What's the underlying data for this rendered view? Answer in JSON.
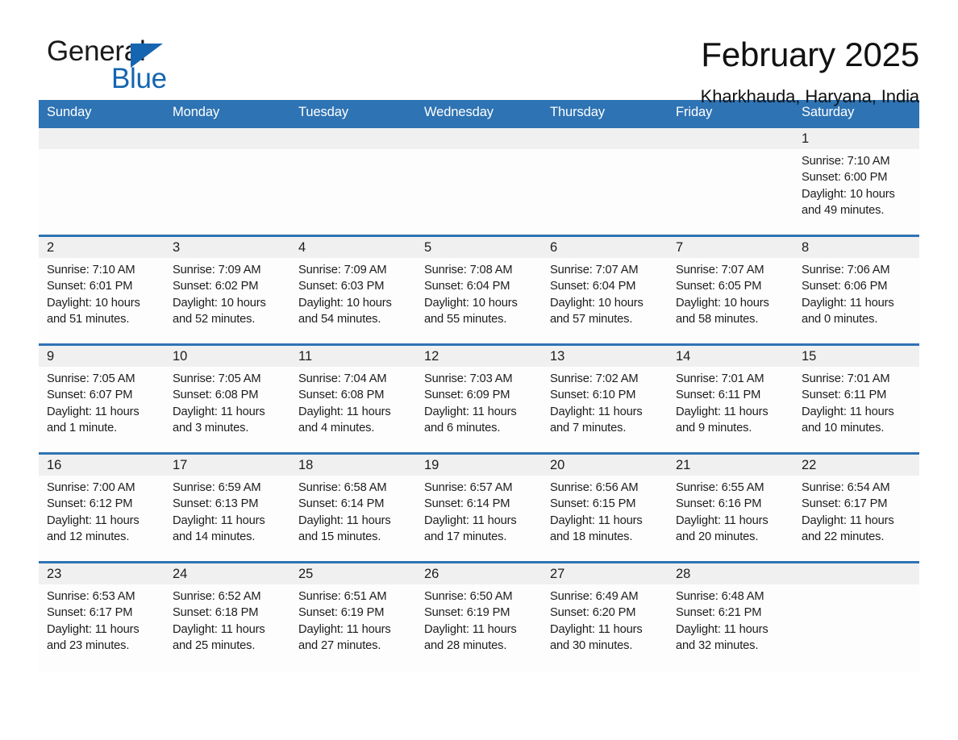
{
  "brand": {
    "name_part1": "General",
    "name_part2": "Blue"
  },
  "header": {
    "title": "February 2025",
    "subtitle": "Kharkhauda, Haryana, India"
  },
  "colors": {
    "accent_blue": "#2e73b3",
    "logo_blue": "#1565b0",
    "daynum_band": "#f0f0f0",
    "cell_bg": "#fdfdfd"
  },
  "weekday_headers": [
    "Sunday",
    "Monday",
    "Tuesday",
    "Wednesday",
    "Thursday",
    "Friday",
    "Saturday"
  ],
  "weeks": [
    [
      {
        "day": "",
        "sunrise": "",
        "sunset": "",
        "daylight": ""
      },
      {
        "day": "",
        "sunrise": "",
        "sunset": "",
        "daylight": ""
      },
      {
        "day": "",
        "sunrise": "",
        "sunset": "",
        "daylight": ""
      },
      {
        "day": "",
        "sunrise": "",
        "sunset": "",
        "daylight": ""
      },
      {
        "day": "",
        "sunrise": "",
        "sunset": "",
        "daylight": ""
      },
      {
        "day": "",
        "sunrise": "",
        "sunset": "",
        "daylight": ""
      },
      {
        "day": "1",
        "sunrise": "Sunrise: 7:10 AM",
        "sunset": "Sunset: 6:00 PM",
        "daylight": "Daylight: 10 hours and 49 minutes."
      }
    ],
    [
      {
        "day": "2",
        "sunrise": "Sunrise: 7:10 AM",
        "sunset": "Sunset: 6:01 PM",
        "daylight": "Daylight: 10 hours and 51 minutes."
      },
      {
        "day": "3",
        "sunrise": "Sunrise: 7:09 AM",
        "sunset": "Sunset: 6:02 PM",
        "daylight": "Daylight: 10 hours and 52 minutes."
      },
      {
        "day": "4",
        "sunrise": "Sunrise: 7:09 AM",
        "sunset": "Sunset: 6:03 PM",
        "daylight": "Daylight: 10 hours and 54 minutes."
      },
      {
        "day": "5",
        "sunrise": "Sunrise: 7:08 AM",
        "sunset": "Sunset: 6:04 PM",
        "daylight": "Daylight: 10 hours and 55 minutes."
      },
      {
        "day": "6",
        "sunrise": "Sunrise: 7:07 AM",
        "sunset": "Sunset: 6:04 PM",
        "daylight": "Daylight: 10 hours and 57 minutes."
      },
      {
        "day": "7",
        "sunrise": "Sunrise: 7:07 AM",
        "sunset": "Sunset: 6:05 PM",
        "daylight": "Daylight: 10 hours and 58 minutes."
      },
      {
        "day": "8",
        "sunrise": "Sunrise: 7:06 AM",
        "sunset": "Sunset: 6:06 PM",
        "daylight": "Daylight: 11 hours and 0 minutes."
      }
    ],
    [
      {
        "day": "9",
        "sunrise": "Sunrise: 7:05 AM",
        "sunset": "Sunset: 6:07 PM",
        "daylight": "Daylight: 11 hours and 1 minute."
      },
      {
        "day": "10",
        "sunrise": "Sunrise: 7:05 AM",
        "sunset": "Sunset: 6:08 PM",
        "daylight": "Daylight: 11 hours and 3 minutes."
      },
      {
        "day": "11",
        "sunrise": "Sunrise: 7:04 AM",
        "sunset": "Sunset: 6:08 PM",
        "daylight": "Daylight: 11 hours and 4 minutes."
      },
      {
        "day": "12",
        "sunrise": "Sunrise: 7:03 AM",
        "sunset": "Sunset: 6:09 PM",
        "daylight": "Daylight: 11 hours and 6 minutes."
      },
      {
        "day": "13",
        "sunrise": "Sunrise: 7:02 AM",
        "sunset": "Sunset: 6:10 PM",
        "daylight": "Daylight: 11 hours and 7 minutes."
      },
      {
        "day": "14",
        "sunrise": "Sunrise: 7:01 AM",
        "sunset": "Sunset: 6:11 PM",
        "daylight": "Daylight: 11 hours and 9 minutes."
      },
      {
        "day": "15",
        "sunrise": "Sunrise: 7:01 AM",
        "sunset": "Sunset: 6:11 PM",
        "daylight": "Daylight: 11 hours and 10 minutes."
      }
    ],
    [
      {
        "day": "16",
        "sunrise": "Sunrise: 7:00 AM",
        "sunset": "Sunset: 6:12 PM",
        "daylight": "Daylight: 11 hours and 12 minutes."
      },
      {
        "day": "17",
        "sunrise": "Sunrise: 6:59 AM",
        "sunset": "Sunset: 6:13 PM",
        "daylight": "Daylight: 11 hours and 14 minutes."
      },
      {
        "day": "18",
        "sunrise": "Sunrise: 6:58 AM",
        "sunset": "Sunset: 6:14 PM",
        "daylight": "Daylight: 11 hours and 15 minutes."
      },
      {
        "day": "19",
        "sunrise": "Sunrise: 6:57 AM",
        "sunset": "Sunset: 6:14 PM",
        "daylight": "Daylight: 11 hours and 17 minutes."
      },
      {
        "day": "20",
        "sunrise": "Sunrise: 6:56 AM",
        "sunset": "Sunset: 6:15 PM",
        "daylight": "Daylight: 11 hours and 18 minutes."
      },
      {
        "day": "21",
        "sunrise": "Sunrise: 6:55 AM",
        "sunset": "Sunset: 6:16 PM",
        "daylight": "Daylight: 11 hours and 20 minutes."
      },
      {
        "day": "22",
        "sunrise": "Sunrise: 6:54 AM",
        "sunset": "Sunset: 6:17 PM",
        "daylight": "Daylight: 11 hours and 22 minutes."
      }
    ],
    [
      {
        "day": "23",
        "sunrise": "Sunrise: 6:53 AM",
        "sunset": "Sunset: 6:17 PM",
        "daylight": "Daylight: 11 hours and 23 minutes."
      },
      {
        "day": "24",
        "sunrise": "Sunrise: 6:52 AM",
        "sunset": "Sunset: 6:18 PM",
        "daylight": "Daylight: 11 hours and 25 minutes."
      },
      {
        "day": "25",
        "sunrise": "Sunrise: 6:51 AM",
        "sunset": "Sunset: 6:19 PM",
        "daylight": "Daylight: 11 hours and 27 minutes."
      },
      {
        "day": "26",
        "sunrise": "Sunrise: 6:50 AM",
        "sunset": "Sunset: 6:19 PM",
        "daylight": "Daylight: 11 hours and 28 minutes."
      },
      {
        "day": "27",
        "sunrise": "Sunrise: 6:49 AM",
        "sunset": "Sunset: 6:20 PM",
        "daylight": "Daylight: 11 hours and 30 minutes."
      },
      {
        "day": "28",
        "sunrise": "Sunrise: 6:48 AM",
        "sunset": "Sunset: 6:21 PM",
        "daylight": "Daylight: 11 hours and 32 minutes."
      },
      {
        "day": "",
        "sunrise": "",
        "sunset": "",
        "daylight": ""
      }
    ]
  ]
}
